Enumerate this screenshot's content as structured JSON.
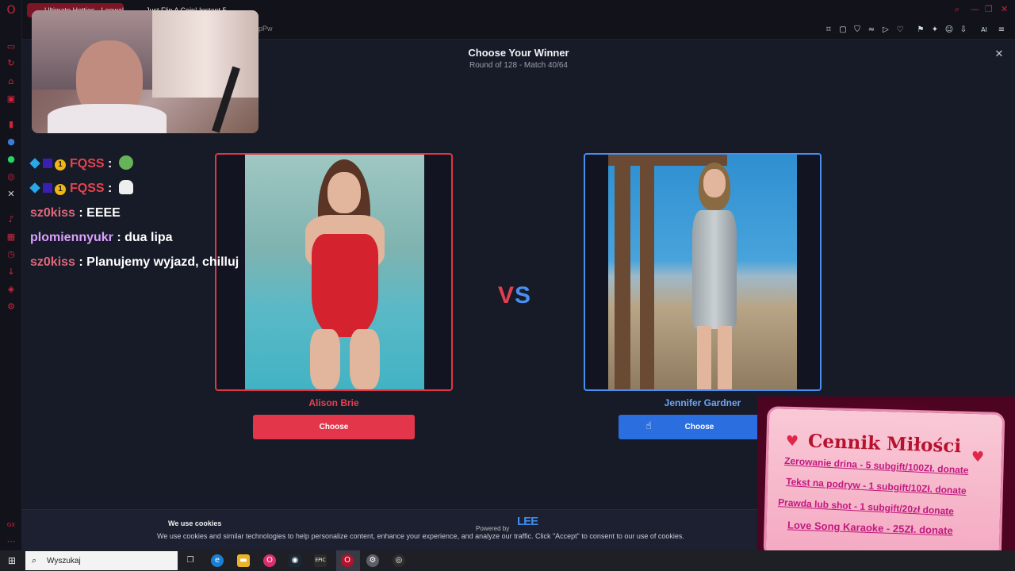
{
  "browser": {
    "tabs": [
      {
        "label": "Ultimate Hotties - Leowal..."
      },
      {
        "label": "Just Flip A Coin! Instant 5..."
      }
    ],
    "url_fragment": "pPw"
  },
  "game": {
    "title": "Choose Your Winner",
    "subtitle": "Round of 128 - Match 40/64",
    "vs": {
      "v": "V",
      "s": "S"
    },
    "left": {
      "name": "Alison Brie",
      "button": "Choose"
    },
    "right": {
      "name": "Jennifer Gardner",
      "button": "Choose"
    }
  },
  "cookie": {
    "title": "We use cookies",
    "text": "We use cookies and similar technologies to help personalize content, enhance your experience, and analyze our traffic. Click \"Accept\" to consent to our use of cookies.",
    "powered": "Powered by",
    "logo": "LEE"
  },
  "chat": [
    {
      "user": "FQSS",
      "message": "",
      "color": "#e8414f",
      "badges": true,
      "emote": "green"
    },
    {
      "user": "FQSS",
      "message": "",
      "color": "#e8414f",
      "badges": true,
      "emote": "white"
    },
    {
      "user": "sz0kiss",
      "message": "EEEE",
      "color": "#e0677b",
      "badges": false
    },
    {
      "user": "plomiennyukr",
      "message": "dua lipa",
      "color": "#d9a0ff",
      "badges": false
    },
    {
      "user": "sz0kiss",
      "message": "Planujemy wyjazd, chilluj",
      "color": "#e0677b",
      "badges": false
    }
  ],
  "badge_number": "1",
  "promo": {
    "title": "Cennik Miłości",
    "lines": [
      "Zerowanie drina - 5 subgift/100Zł. donate",
      "Tekst na podryw - 1 subgift/10Zł. donate",
      "Prawda lub shot - 1 subgift/20zł donate",
      "Love Song Karaoke - 25Zł. donate"
    ]
  },
  "taskbar": {
    "search_placeholder": "Wyszukaj"
  },
  "colors": {
    "red_accent": "#e3364a",
    "blue_accent": "#2a6ee0",
    "background": "#171b27"
  }
}
